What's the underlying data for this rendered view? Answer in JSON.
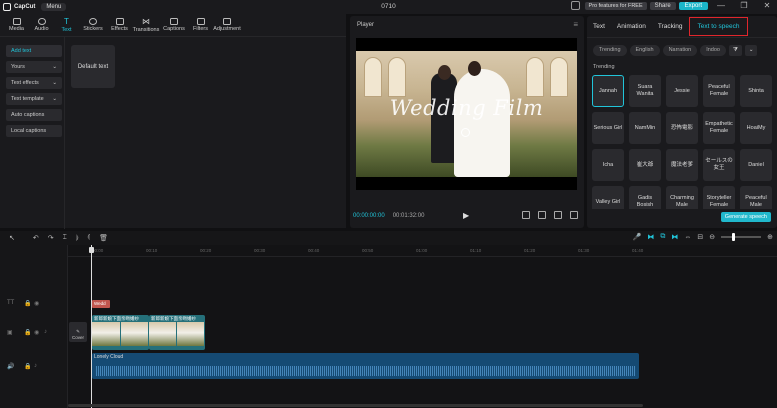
{
  "titlebar": {
    "app_name": "CapCut",
    "menu_label": "Menu",
    "project_title": "0710",
    "pro_label": "Pro features for FREE",
    "share_label": "Share",
    "export_label": "Export",
    "minimize": "—",
    "maximize": "❐",
    "close": "✕"
  },
  "toolbar": {
    "tools": [
      {
        "label": "Media",
        "icon": "media-icon"
      },
      {
        "label": "Audio",
        "icon": "audio-icon"
      },
      {
        "label": "Text",
        "icon": "text-icon",
        "glyph": "T"
      },
      {
        "label": "Stickers",
        "icon": "stickers-icon"
      },
      {
        "label": "Effects",
        "icon": "effects-icon"
      },
      {
        "label": "Transitions",
        "icon": "transitions-icon",
        "glyph": "⋈"
      },
      {
        "label": "Captions",
        "icon": "captions-icon"
      },
      {
        "label": "Filters",
        "icon": "filters-icon"
      },
      {
        "label": "Adjustment",
        "icon": "adjustment-icon"
      }
    ]
  },
  "leftpanel": {
    "nav": [
      {
        "label": "Add text",
        "chev": ""
      },
      {
        "label": "Yours",
        "chev": "⌄"
      },
      {
        "label": "Text effects",
        "chev": "⌄"
      },
      {
        "label": "Text template",
        "chev": "⌄"
      },
      {
        "label": "Auto captions",
        "chev": ""
      },
      {
        "label": "Local captions",
        "chev": ""
      }
    ],
    "default_card": "Default text"
  },
  "player": {
    "title": "Player",
    "menu": "≡",
    "video_title": "Wedding Film",
    "current_time": "00:00:00:00",
    "duration": "00:01:32:00",
    "play": "▶"
  },
  "rightpanel": {
    "tabs": [
      "Text",
      "Animation",
      "Tracking",
      "Text to speech"
    ],
    "filters": [
      "Trending",
      "English",
      "Narration",
      "Indoo"
    ],
    "filter_icon": "⧩",
    "filter_more": "⌄",
    "section_label": "Trending",
    "voices": [
      "Jannah",
      "Suara Wanita",
      "Jessie",
      "Peaceful Female",
      "Shinta",
      "Serious Girl",
      "NamMin",
      "恐怖電影",
      "Empathetic Female",
      "HoaiMy",
      "Icha",
      "崔大爺",
      "魔法老爹",
      "セールスの女王",
      "Daniel",
      "Valley Girl",
      "Gadis Bosish",
      "Charming Male",
      "Storyteller Female",
      "Peaceful Male"
    ],
    "generate_label": "Generate speech"
  },
  "timeline_tools": {
    "select": "↖",
    "undo": "↶",
    "redo": "↷",
    "split": "⌶",
    "split_left": "⦈",
    "split_right": "⦇",
    "delete": "🗑",
    "mic": "🎤",
    "link1": "⧓",
    "link2": "⧉",
    "link3": "⧓",
    "align": "⇔",
    "preview": "⊟",
    "zoom_out": "⊖",
    "zoom_in": "⊕",
    "zoom_level": 0.3
  },
  "timeline": {
    "ticks": [
      "00:00",
      "00:10",
      "00:20",
      "00:30",
      "00:40",
      "00:50",
      "01:00",
      "01:10",
      "01:20",
      "01:30",
      "01:40"
    ],
    "text_clip": "Wedd",
    "video_clip_label": "新郎新娘下面亲吻婚纱",
    "audio_clip_label": "Lonely Cloud",
    "cover_label": "Cover",
    "cover_icon": "✎",
    "track_icons": [
      "TT",
      "▣",
      "🔊"
    ]
  }
}
